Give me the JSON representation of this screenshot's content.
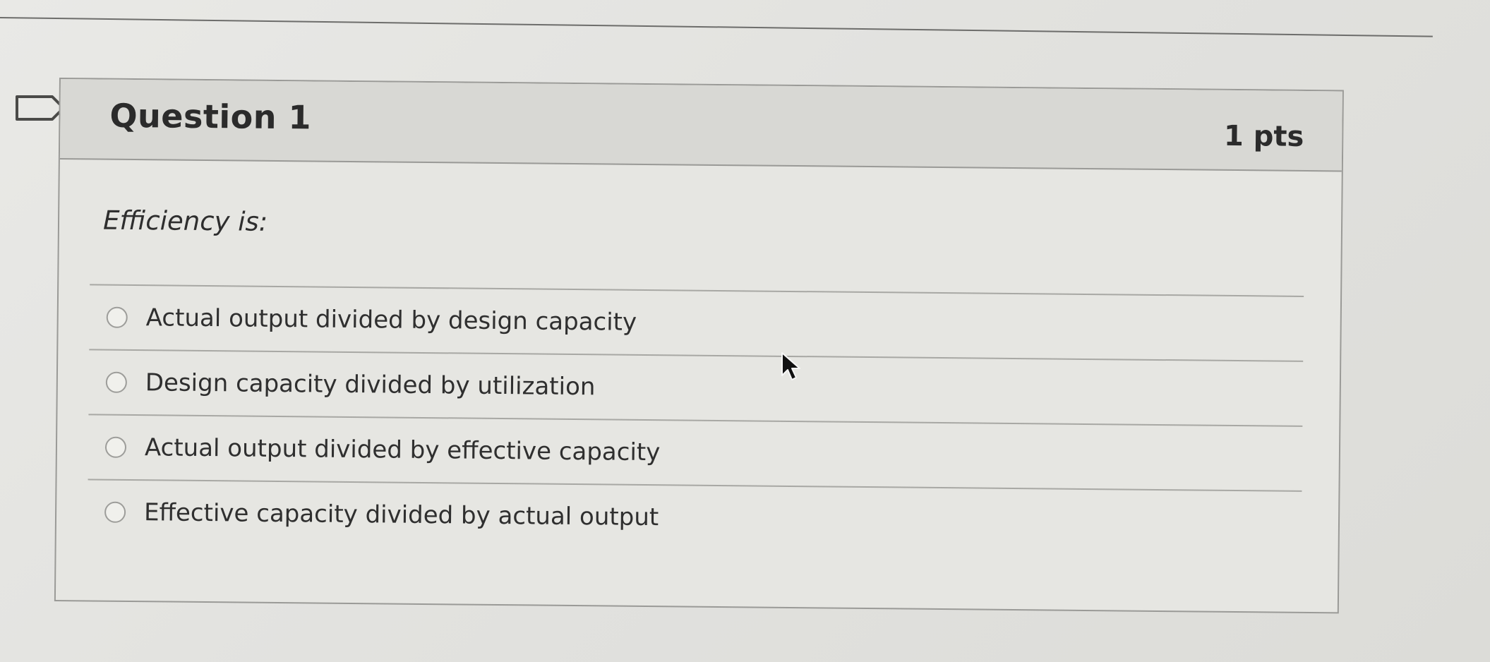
{
  "question": {
    "title": "Question 1",
    "points": "1 pts",
    "prompt": "Efficiency is:",
    "answers": [
      {
        "label": "Actual output divided by design capacity"
      },
      {
        "label": "Design capacity divided by utilization"
      },
      {
        "label": "Actual output divided by effective capacity"
      },
      {
        "label": "Effective capacity divided by actual output"
      }
    ]
  },
  "icons": {
    "flag": "flag-icon",
    "cursor": "mouse-cursor-icon"
  },
  "colors": {
    "background": "#e4e4e1",
    "header": "#d8d8d4",
    "border": "#9a9a97",
    "text": "#2b2b2b"
  }
}
